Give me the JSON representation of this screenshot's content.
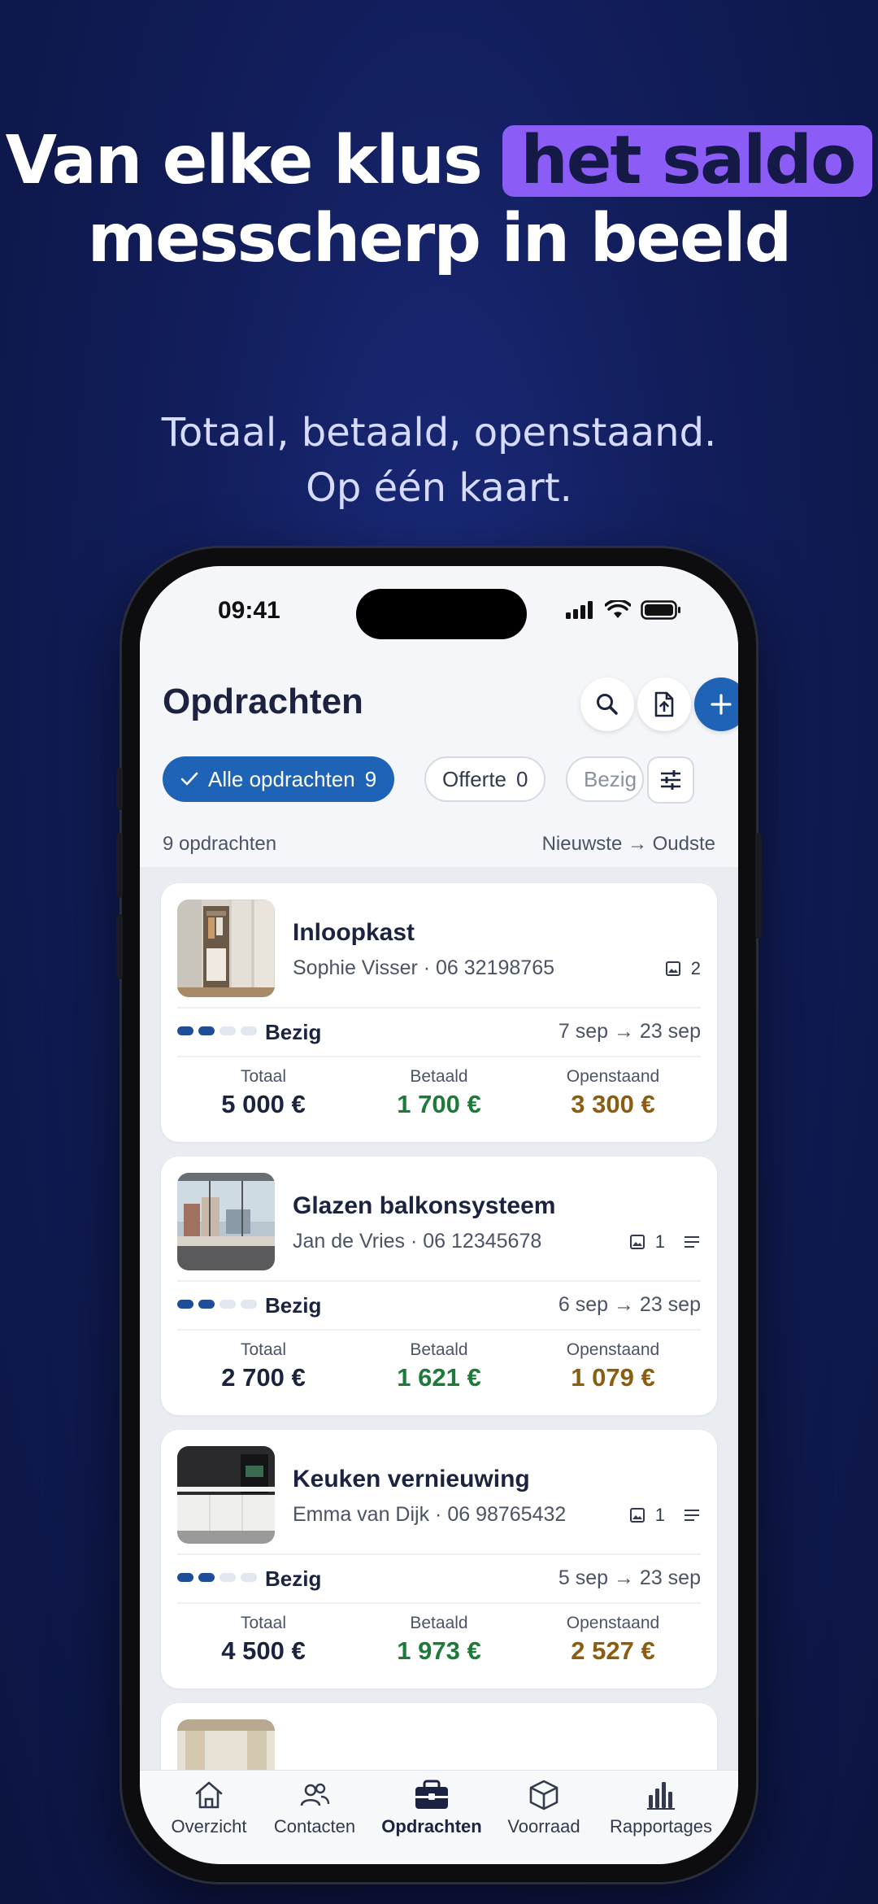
{
  "promo": {
    "headline_part1": "Van elke klus",
    "headline_highlight": "het saldo",
    "headline_line2": "messcherp in beeld",
    "subline_line1": "Totaal, betaald, openstaand.",
    "subline_line2": "Op één kaart."
  },
  "status_bar": {
    "time": "09:41"
  },
  "header": {
    "title": "Opdrachten"
  },
  "filters": [
    {
      "label": "Alle opdrachten",
      "count": "9",
      "active": true
    },
    {
      "label": "Offerte",
      "count": "0",
      "active": false
    },
    {
      "label": "Bezig",
      "count": "",
      "active": false
    }
  ],
  "list_info": {
    "count_label": "9 opdrachten",
    "sort_label": "Nieuwste → Oudste"
  },
  "labels": {
    "totaal": "Totaal",
    "betaald": "Betaald",
    "openstaand": "Openstaand"
  },
  "jobs": [
    {
      "name": "Inloopkast",
      "client": "Sophie Visser",
      "phone": "· 06 32198765",
      "photos": "2",
      "has_notes": false,
      "status": "Bezig",
      "progress_steps": 2,
      "dates": "7 sep → 23 sep",
      "totaal": "5 000 €",
      "betaald": "1 700 €",
      "openstaand": "3 300 €"
    },
    {
      "name": "Glazen balkonsysteem",
      "client": "Jan de Vries",
      "phone": "· 06 12345678",
      "photos": "1",
      "has_notes": true,
      "status": "Bezig",
      "progress_steps": 2,
      "dates": "6 sep → 23 sep",
      "totaal": "2 700 €",
      "betaald": "1 621 €",
      "openstaand": "1 079 €"
    },
    {
      "name": "Keuken vernieuwing",
      "client": "Emma van Dijk",
      "phone": "· 06 98765432",
      "photos": "1",
      "has_notes": true,
      "status": "Bezig",
      "progress_steps": 2,
      "dates": "5 sep → 23 sep",
      "totaal": "4 500 €",
      "betaald": "1 973 €",
      "openstaand": "2 527 €"
    }
  ],
  "tabbar": [
    {
      "label": "Overzicht",
      "icon": "home-icon",
      "active": false
    },
    {
      "label": "Contacten",
      "icon": "contacts-icon",
      "active": false
    },
    {
      "label": "Opdrachten",
      "icon": "briefcase-icon",
      "active": true
    },
    {
      "label": "Voorraad",
      "icon": "box-icon",
      "active": false
    },
    {
      "label": "Rapportages",
      "icon": "bar-chart-icon",
      "active": false
    }
  ],
  "colors": {
    "accent": "#1f63b6",
    "highlight": "#8b5cf6",
    "paid": "#1e7a3a",
    "open": "#8a5d10"
  }
}
